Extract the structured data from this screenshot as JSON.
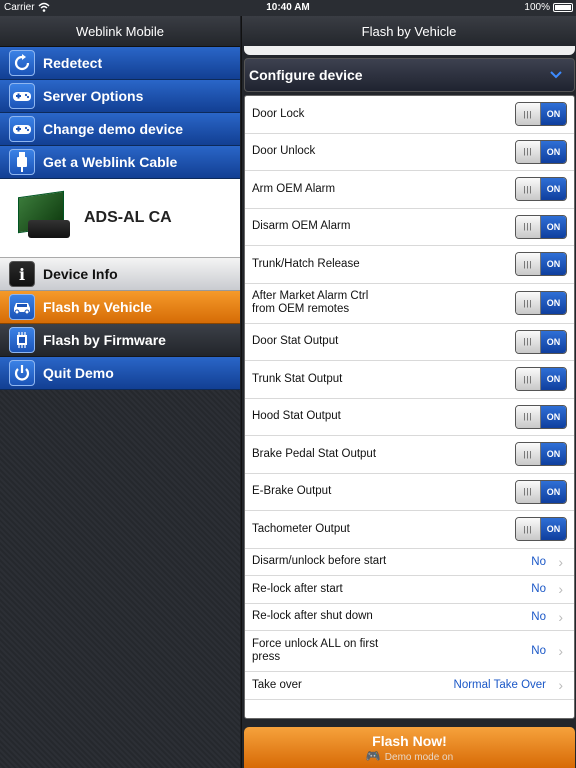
{
  "status_bar": {
    "carrier": "Carrier",
    "time": "10:40 AM",
    "battery": "100%"
  },
  "left": {
    "title": "Weblink Mobile",
    "top_items": [
      {
        "label": "Redetect",
        "icon": "refresh-icon"
      },
      {
        "label": "Server Options",
        "icon": "gamepad-icon"
      },
      {
        "label": "Change demo device",
        "icon": "gamepad-icon"
      },
      {
        "label": "Get a Weblink Cable",
        "icon": "usb-icon"
      }
    ],
    "device": {
      "name": "ADS-AL CA"
    },
    "bottom_items": [
      {
        "label": "Device Info",
        "icon": "info-icon"
      },
      {
        "label": "Flash by Vehicle",
        "icon": "car-icon"
      },
      {
        "label": "Flash by Firmware",
        "icon": "chip-icon"
      },
      {
        "label": "Quit Demo",
        "icon": "power-icon"
      }
    ]
  },
  "right": {
    "title": "Flash by Vehicle",
    "section": "Configure device",
    "toggle_on_label": "ON",
    "toggles": [
      {
        "label": "Door Lock"
      },
      {
        "label": "Door Unlock"
      },
      {
        "label": "Arm OEM Alarm"
      },
      {
        "label": "Disarm OEM Alarm"
      },
      {
        "label": "Trunk/Hatch Release"
      },
      {
        "label": "After Market Alarm Ctrl from OEM remotes"
      },
      {
        "label": "Door Stat Output"
      },
      {
        "label": "Trunk Stat Output"
      },
      {
        "label": "Hood Stat Output"
      },
      {
        "label": "Brake Pedal Stat Output"
      },
      {
        "label": "E-Brake Output"
      },
      {
        "label": "Tachometer Output"
      }
    ],
    "selects": [
      {
        "label": "Disarm/unlock before start",
        "value": "No"
      },
      {
        "label": "Re-lock after start",
        "value": "No"
      },
      {
        "label": "Re-lock after shut down",
        "value": "No"
      },
      {
        "label": "Force unlock ALL on first press",
        "value": "No"
      },
      {
        "label": "Take over",
        "value": "Normal Take Over"
      }
    ],
    "flash_button": "Flash Now!",
    "demo_mode": "Demo mode on"
  }
}
